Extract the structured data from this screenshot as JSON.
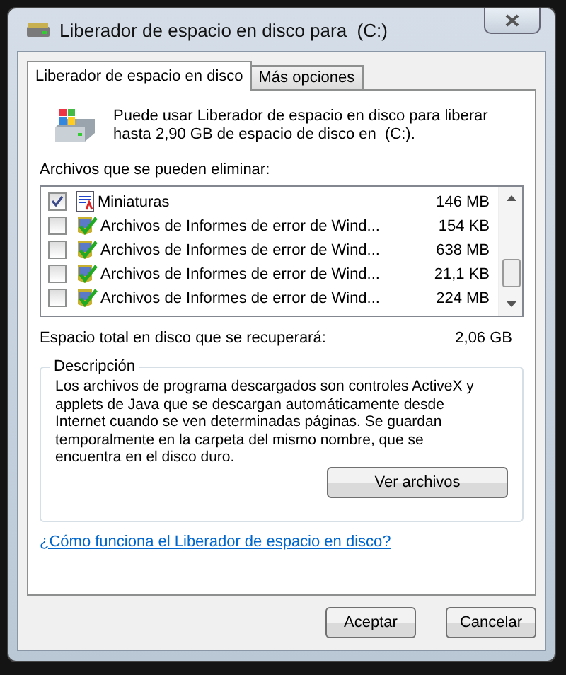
{
  "window": {
    "title": "Liberador de espacio en disco para  (C:)"
  },
  "tabs": [
    {
      "label": "Liberador de espacio en disco",
      "selected": true
    },
    {
      "label": "Más opciones",
      "selected": false
    }
  ],
  "intro": "Puede usar Liberador de espacio en disco para liberar hasta 2,90 GB de espacio de disco en  (C:).",
  "files_label": "Archivos que se pueden eliminar:",
  "files": [
    {
      "kind": "thumbnails",
      "name": "Miniaturas",
      "size": "146 MB",
      "checked": true
    },
    {
      "kind": "report",
      "name": "Archivos de Informes de error de Wind...",
      "size": "154 KB",
      "checked": false
    },
    {
      "kind": "report",
      "name": "Archivos de Informes de error de Wind...",
      "size": "638 MB",
      "checked": false
    },
    {
      "kind": "report",
      "name": "Archivos de Informes de error de Wind...",
      "size": "21,1 KB",
      "checked": false
    },
    {
      "kind": "report",
      "name": "Archivos de Informes de error de Wind...",
      "size": "224 MB",
      "checked": false
    }
  ],
  "total": {
    "label": "Espacio total en disco que se recuperará:",
    "value": "2,06 GB"
  },
  "description": {
    "title": "Descripción",
    "text": "Los archivos de programa descargados son controles ActiveX y applets de Java que se descargan automáticamente desde Internet cuando se ven determinadas páginas. Se guardan temporalmente en la carpeta del mismo nombre, que se encuentra en el disco duro.",
    "button": "Ver archivos"
  },
  "help_link": "¿Cómo funciona el Liberador de espacio en disco?",
  "buttons": [
    "Aceptar",
    "Cancelar"
  ]
}
